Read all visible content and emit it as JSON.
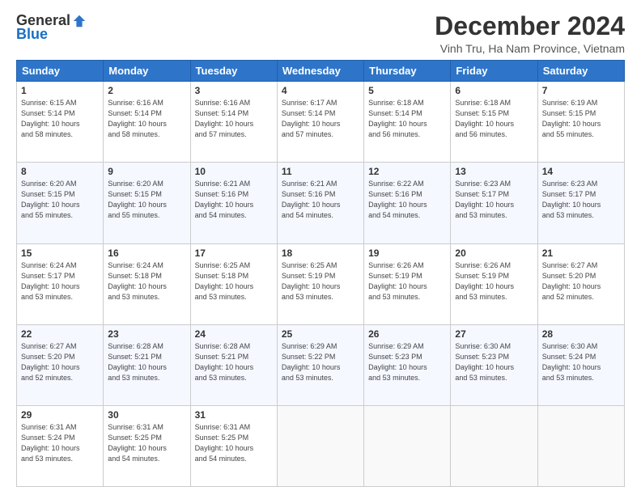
{
  "header": {
    "logo_general": "General",
    "logo_blue": "Blue",
    "title": "December 2024",
    "location": "Vinh Tru, Ha Nam Province, Vietnam"
  },
  "days_of_week": [
    "Sunday",
    "Monday",
    "Tuesday",
    "Wednesday",
    "Thursday",
    "Friday",
    "Saturday"
  ],
  "weeks": [
    [
      {
        "day": "1",
        "info": "Sunrise: 6:15 AM\nSunset: 5:14 PM\nDaylight: 10 hours\nand 58 minutes."
      },
      {
        "day": "2",
        "info": "Sunrise: 6:16 AM\nSunset: 5:14 PM\nDaylight: 10 hours\nand 58 minutes."
      },
      {
        "day": "3",
        "info": "Sunrise: 6:16 AM\nSunset: 5:14 PM\nDaylight: 10 hours\nand 57 minutes."
      },
      {
        "day": "4",
        "info": "Sunrise: 6:17 AM\nSunset: 5:14 PM\nDaylight: 10 hours\nand 57 minutes."
      },
      {
        "day": "5",
        "info": "Sunrise: 6:18 AM\nSunset: 5:14 PM\nDaylight: 10 hours\nand 56 minutes."
      },
      {
        "day": "6",
        "info": "Sunrise: 6:18 AM\nSunset: 5:15 PM\nDaylight: 10 hours\nand 56 minutes."
      },
      {
        "day": "7",
        "info": "Sunrise: 6:19 AM\nSunset: 5:15 PM\nDaylight: 10 hours\nand 55 minutes."
      }
    ],
    [
      {
        "day": "8",
        "info": "Sunrise: 6:20 AM\nSunset: 5:15 PM\nDaylight: 10 hours\nand 55 minutes."
      },
      {
        "day": "9",
        "info": "Sunrise: 6:20 AM\nSunset: 5:15 PM\nDaylight: 10 hours\nand 55 minutes."
      },
      {
        "day": "10",
        "info": "Sunrise: 6:21 AM\nSunset: 5:16 PM\nDaylight: 10 hours\nand 54 minutes."
      },
      {
        "day": "11",
        "info": "Sunrise: 6:21 AM\nSunset: 5:16 PM\nDaylight: 10 hours\nand 54 minutes."
      },
      {
        "day": "12",
        "info": "Sunrise: 6:22 AM\nSunset: 5:16 PM\nDaylight: 10 hours\nand 54 minutes."
      },
      {
        "day": "13",
        "info": "Sunrise: 6:23 AM\nSunset: 5:17 PM\nDaylight: 10 hours\nand 53 minutes."
      },
      {
        "day": "14",
        "info": "Sunrise: 6:23 AM\nSunset: 5:17 PM\nDaylight: 10 hours\nand 53 minutes."
      }
    ],
    [
      {
        "day": "15",
        "info": "Sunrise: 6:24 AM\nSunset: 5:17 PM\nDaylight: 10 hours\nand 53 minutes."
      },
      {
        "day": "16",
        "info": "Sunrise: 6:24 AM\nSunset: 5:18 PM\nDaylight: 10 hours\nand 53 minutes."
      },
      {
        "day": "17",
        "info": "Sunrise: 6:25 AM\nSunset: 5:18 PM\nDaylight: 10 hours\nand 53 minutes."
      },
      {
        "day": "18",
        "info": "Sunrise: 6:25 AM\nSunset: 5:19 PM\nDaylight: 10 hours\nand 53 minutes."
      },
      {
        "day": "19",
        "info": "Sunrise: 6:26 AM\nSunset: 5:19 PM\nDaylight: 10 hours\nand 53 minutes."
      },
      {
        "day": "20",
        "info": "Sunrise: 6:26 AM\nSunset: 5:19 PM\nDaylight: 10 hours\nand 53 minutes."
      },
      {
        "day": "21",
        "info": "Sunrise: 6:27 AM\nSunset: 5:20 PM\nDaylight: 10 hours\nand 52 minutes."
      }
    ],
    [
      {
        "day": "22",
        "info": "Sunrise: 6:27 AM\nSunset: 5:20 PM\nDaylight: 10 hours\nand 52 minutes."
      },
      {
        "day": "23",
        "info": "Sunrise: 6:28 AM\nSunset: 5:21 PM\nDaylight: 10 hours\nand 53 minutes."
      },
      {
        "day": "24",
        "info": "Sunrise: 6:28 AM\nSunset: 5:21 PM\nDaylight: 10 hours\nand 53 minutes."
      },
      {
        "day": "25",
        "info": "Sunrise: 6:29 AM\nSunset: 5:22 PM\nDaylight: 10 hours\nand 53 minutes."
      },
      {
        "day": "26",
        "info": "Sunrise: 6:29 AM\nSunset: 5:23 PM\nDaylight: 10 hours\nand 53 minutes."
      },
      {
        "day": "27",
        "info": "Sunrise: 6:30 AM\nSunset: 5:23 PM\nDaylight: 10 hours\nand 53 minutes."
      },
      {
        "day": "28",
        "info": "Sunrise: 6:30 AM\nSunset: 5:24 PM\nDaylight: 10 hours\nand 53 minutes."
      }
    ],
    [
      {
        "day": "29",
        "info": "Sunrise: 6:31 AM\nSunset: 5:24 PM\nDaylight: 10 hours\nand 53 minutes."
      },
      {
        "day": "30",
        "info": "Sunrise: 6:31 AM\nSunset: 5:25 PM\nDaylight: 10 hours\nand 54 minutes."
      },
      {
        "day": "31",
        "info": "Sunrise: 6:31 AM\nSunset: 5:25 PM\nDaylight: 10 hours\nand 54 minutes."
      },
      {
        "day": "",
        "info": ""
      },
      {
        "day": "",
        "info": ""
      },
      {
        "day": "",
        "info": ""
      },
      {
        "day": "",
        "info": ""
      }
    ]
  ]
}
